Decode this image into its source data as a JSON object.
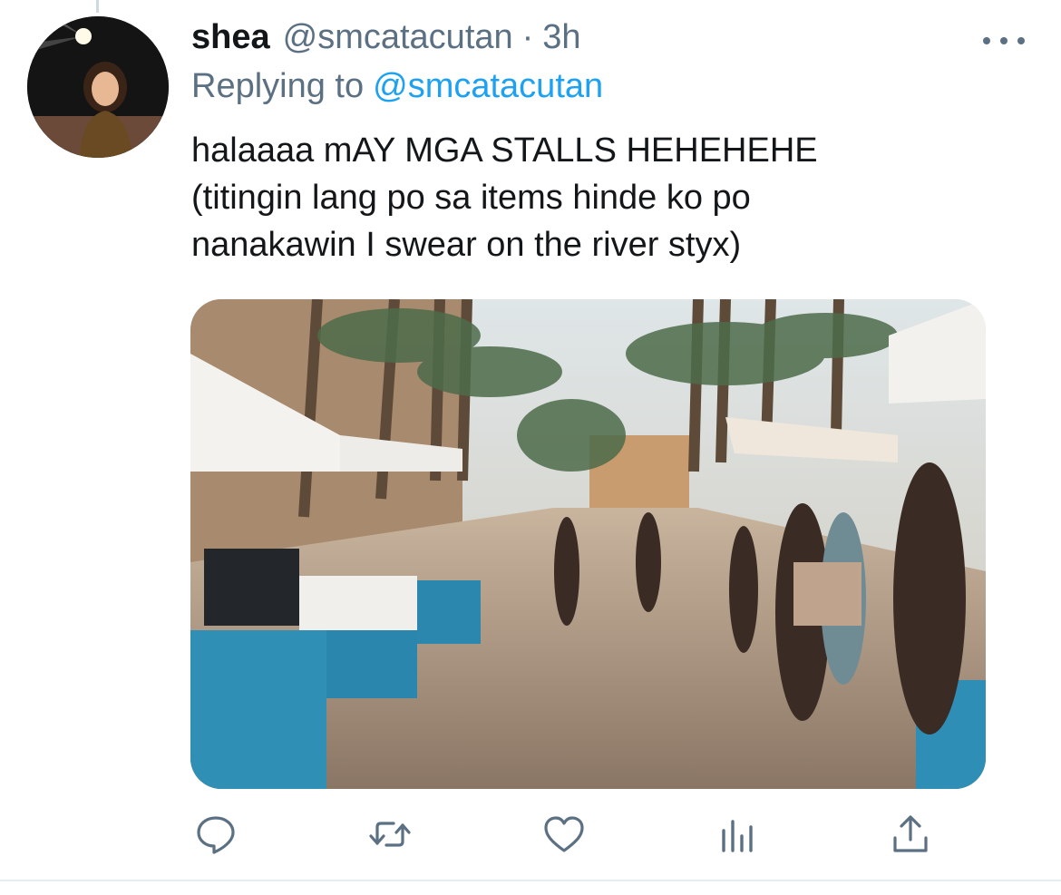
{
  "tweet": {
    "display_name": "shea",
    "handle": "@smcatacutan",
    "separator": "·",
    "time": "3h",
    "reply_prefix": "Replying to",
    "reply_handle": "@smcatacutan",
    "text": "halaaaa mAY MGA STALLS HEHEHEHE\n(titingin lang po sa items hinde ko po\nnanakawin I swear on the river styx)"
  },
  "actions": {
    "reply_icon": "speech-bubble-icon",
    "retweet_icon": "retweet-icon",
    "like_icon": "heart-icon",
    "analytics_icon": "bar-chart-icon",
    "share_icon": "upload-icon"
  },
  "colors": {
    "text": "#14171a",
    "secondary": "#5b7083",
    "link": "#1da1f2",
    "border": "#e6ecf0"
  }
}
